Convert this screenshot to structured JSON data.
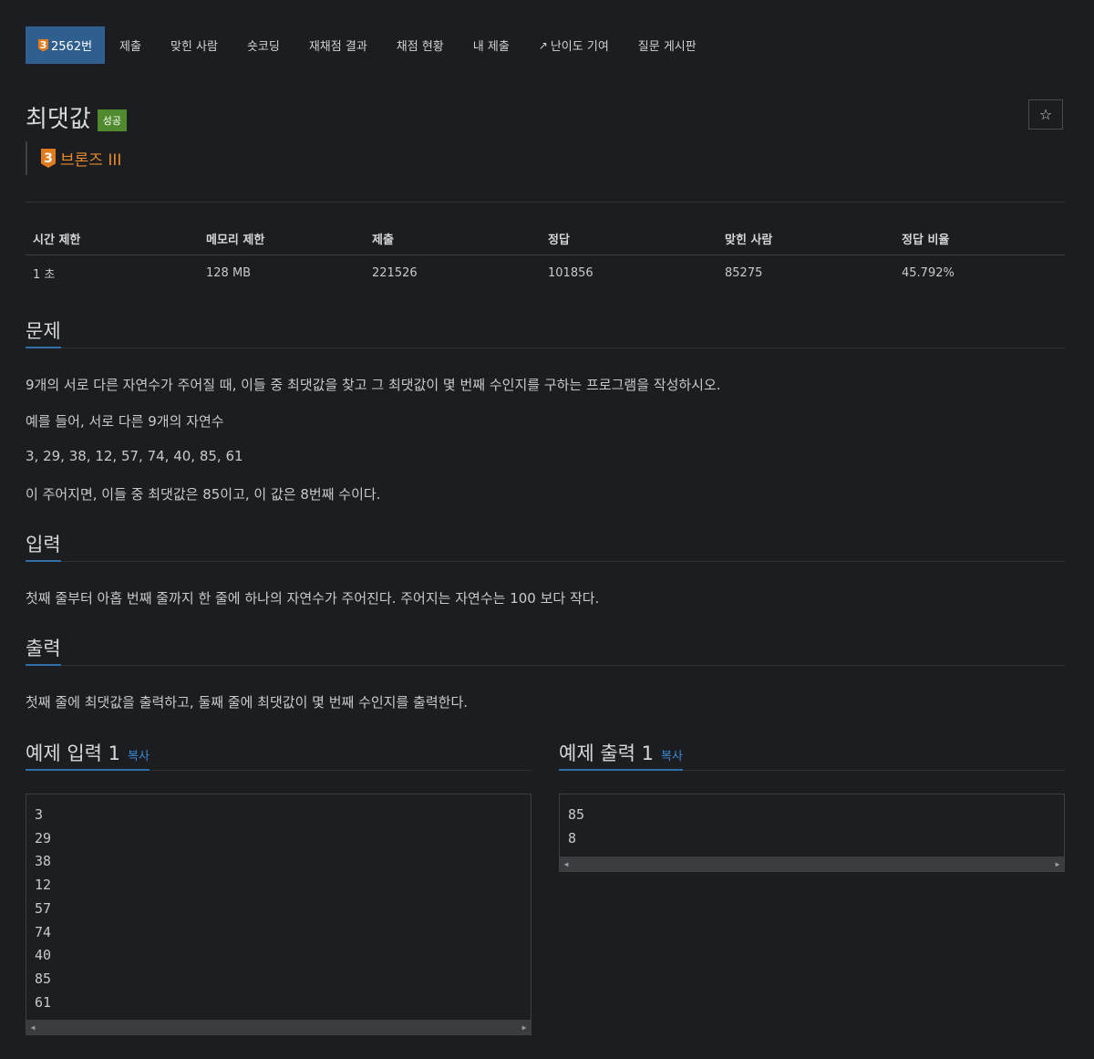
{
  "nav": {
    "problem_badge": "3",
    "problem_tab": "2562번",
    "tabs": [
      "제출",
      "맞힌 사람",
      "숏코딩",
      "재채점 결과",
      "채점 현황",
      "내 제출",
      "난이도 기여",
      "질문 게시판"
    ]
  },
  "problem": {
    "title": "최댓값",
    "status_badge": "성공",
    "tier_number": "3",
    "tier_label": "브론즈 III"
  },
  "stats": {
    "headers": [
      "시간 제한",
      "메모리 제한",
      "제출",
      "정답",
      "맞힌 사람",
      "정답 비율"
    ],
    "values": [
      "1 초",
      "128 MB",
      "221526",
      "101856",
      "85275",
      "45.792%"
    ]
  },
  "sections": {
    "problem_heading": "문제",
    "problem_lines": [
      "9개의 서로 다른 자연수가 주어질 때, 이들 중 최댓값을 찾고 그 최댓값이 몇 번째 수인지를 구하는 프로그램을 작성하시오.",
      "예를 들어, 서로 다른 9개의 자연수",
      "3, 29, 38, 12, 57, 74, 40, 85, 61",
      "이 주어지면, 이들 중 최댓값은 85이고, 이 값은 8번째 수이다."
    ],
    "input_heading": "입력",
    "input_text": "첫째 줄부터 아홉 번째 줄까지 한 줄에 하나의 자연수가 주어진다. 주어지는 자연수는 100 보다 작다.",
    "output_heading": "출력",
    "output_text": "첫째 줄에 최댓값을 출력하고, 둘째 줄에 최댓값이 몇 번째 수인지를 출력한다."
  },
  "examples": {
    "input_heading": "예제 입력 1",
    "output_heading": "예제 출력 1",
    "copy_label": "복사",
    "input_lines": [
      "3",
      "29",
      "38",
      "12",
      "57",
      "74",
      "40",
      "85",
      "61"
    ],
    "output_lines": [
      "85",
      "8"
    ]
  },
  "colors": {
    "background": "#1c1d20",
    "accent": "#2f5f8f",
    "success": "#4f8a2f",
    "bronze": "#e07b1f",
    "link": "#3b8ad6"
  }
}
